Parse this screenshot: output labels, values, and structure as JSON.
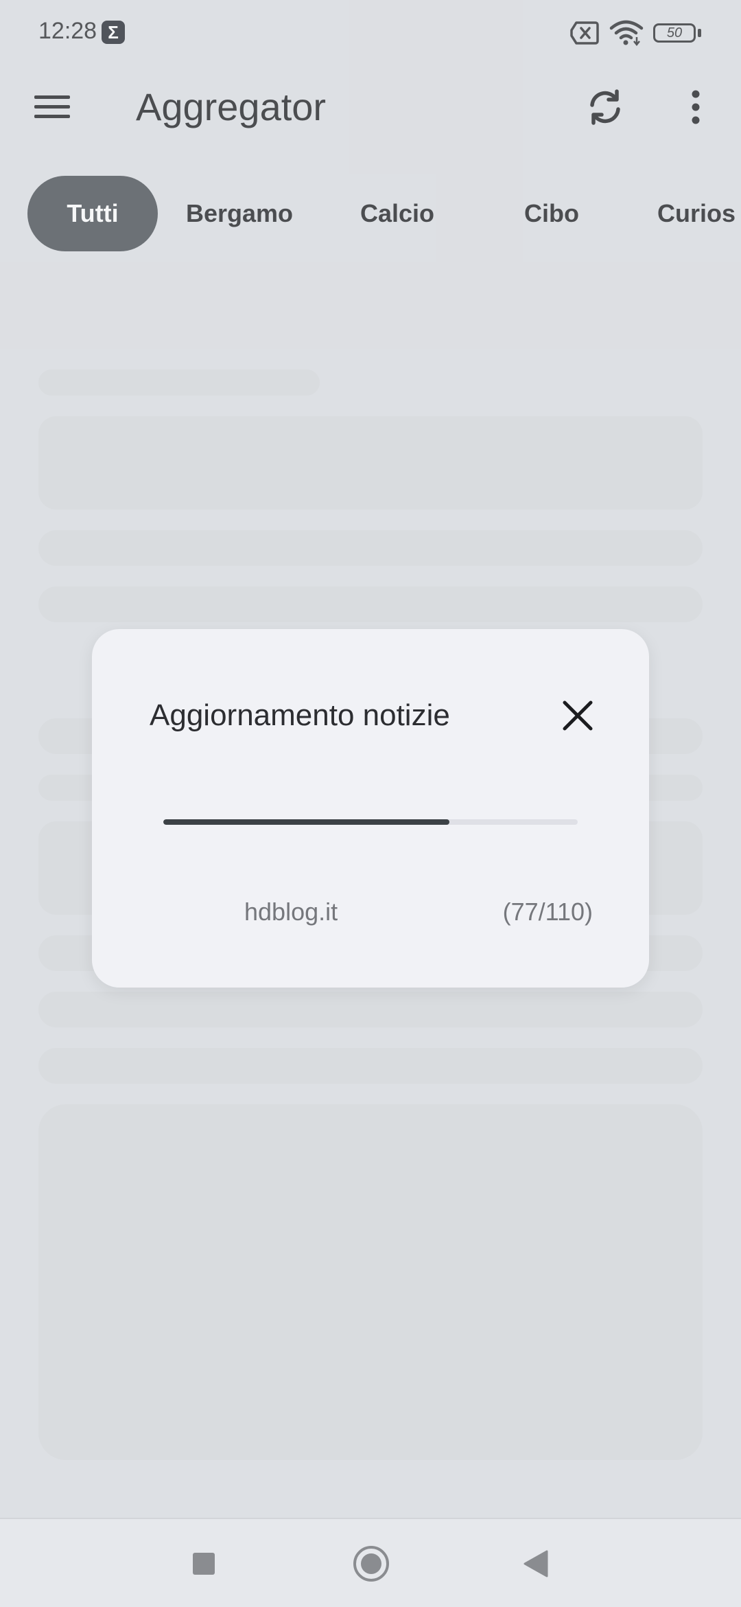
{
  "status_bar": {
    "time": "12:28",
    "app_icon_glyph": "Σ",
    "battery_level": "50",
    "icons": [
      "sim-card-off-icon",
      "wifi-icon",
      "battery-icon"
    ]
  },
  "app_bar": {
    "title": "Aggregator",
    "icons": [
      "menu-icon",
      "refresh-icon",
      "more-vert-icon"
    ]
  },
  "categories": {
    "items": [
      "Tutti",
      "Bergamo",
      "Calcio",
      "Cibo",
      "Curios"
    ],
    "selected": "Tutti"
  },
  "dialog": {
    "title": "Aggiornamento notizie",
    "source": "hdblog.it",
    "count": "(77/110)",
    "progress_fraction": 0.69,
    "close_icon": "close-icon"
  },
  "nav_bar": {
    "icons": [
      "recents-square-icon",
      "home-circle-icon",
      "back-triangle-icon"
    ]
  },
  "colors": {
    "background": "#dee0e4",
    "chip_active": "#474d52",
    "dialog_bg": "#f1f2f6",
    "progress": "#3c4246"
  }
}
